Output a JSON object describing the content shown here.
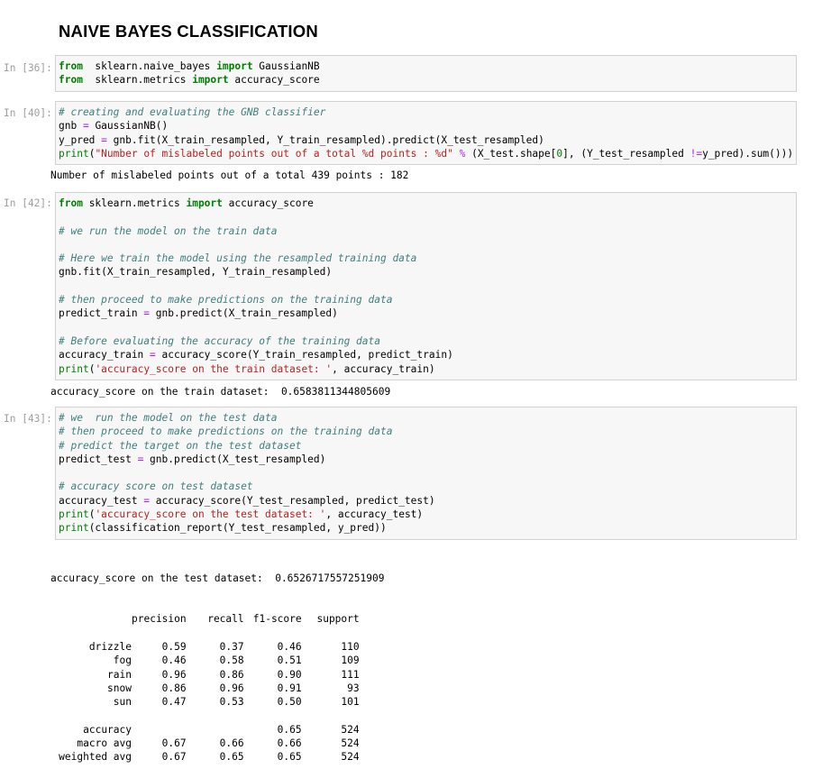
{
  "heading": "NAIVE BAYES CLASSIFICATION",
  "cells": [
    {
      "prompt": "In [36]:",
      "lines": [
        [
          [
            "kw",
            "from"
          ],
          [
            "",
            "  sklearn.naive_bayes "
          ],
          [
            "kw",
            "import"
          ],
          [
            "",
            " GaussianNB"
          ]
        ],
        [
          [
            "kw",
            "from"
          ],
          [
            "",
            "  sklearn.metrics "
          ],
          [
            "kw",
            "import"
          ],
          [
            "",
            " accuracy_score"
          ]
        ]
      ]
    },
    {
      "prompt": "In [40]:",
      "lines": [
        [
          [
            "cm",
            "# creating and evaluating the GNB classifier"
          ]
        ],
        [
          [
            "",
            "gnb "
          ],
          [
            "op",
            "="
          ],
          [
            "",
            " GaussianNB()"
          ]
        ],
        [
          [
            "",
            "y_pred "
          ],
          [
            "op",
            "="
          ],
          [
            "",
            " gnb.fit(X_train_resampled, Y_train_resampled).predict(X_test_resampled)"
          ]
        ],
        [
          [
            "nm",
            "print"
          ],
          [
            "",
            "("
          ],
          [
            "st",
            "\"Number of mislabeled points out of a total %d points : %d\""
          ],
          [
            "",
            " "
          ],
          [
            "op",
            "%"
          ],
          [
            "",
            " (X_test.shape["
          ],
          [
            "nm",
            "0"
          ],
          [
            "",
            "], (Y_test_resampled "
          ],
          [
            "op",
            "!="
          ],
          [
            "",
            "y_pred).sum()))"
          ]
        ]
      ],
      "output": [
        "Number of mislabeled points out of a total 439 points : 182"
      ]
    },
    {
      "prompt": "In [42]:",
      "lines": [
        [
          [
            "kw",
            "from"
          ],
          [
            "",
            " sklearn.metrics "
          ],
          [
            "kw",
            "import"
          ],
          [
            "",
            " accuracy_score"
          ]
        ],
        [],
        [
          [
            "cm",
            "# we run the model on the train data"
          ]
        ],
        [],
        [
          [
            "cm",
            "# Here we train the model using the resampled training data"
          ]
        ],
        [
          [
            "",
            "gnb.fit(X_train_resampled, Y_train_resampled)"
          ]
        ],
        [],
        [
          [
            "cm",
            "# then proceed to make predictions on the training data"
          ]
        ],
        [
          [
            "",
            "predict_train "
          ],
          [
            "op",
            "="
          ],
          [
            "",
            " gnb.predict(X_train_resampled)"
          ]
        ],
        [],
        [
          [
            "cm",
            "# Before evaluating the accuracy of the training data"
          ]
        ],
        [
          [
            "",
            "accuracy_train "
          ],
          [
            "op",
            "="
          ],
          [
            "",
            " accuracy_score(Y_train_resampled, predict_train)"
          ]
        ],
        [
          [
            "nm",
            "print"
          ],
          [
            "",
            "("
          ],
          [
            "st",
            "'accuracy_score on the train dataset: '"
          ],
          [
            "",
            ", accuracy_train)"
          ]
        ]
      ],
      "output": [
        "accuracy_score on the train dataset:  0.6583811344805609"
      ]
    },
    {
      "prompt": "In [43]:",
      "lines": [
        [
          [
            "cm",
            "# we  run the model on the test data"
          ]
        ],
        [
          [
            "cm",
            "# then proceed to make predictions on the training data"
          ]
        ],
        [
          [
            "cm",
            "# predict the target on the test dataset"
          ]
        ],
        [
          [
            "",
            "predict_test "
          ],
          [
            "op",
            "="
          ],
          [
            "",
            " gnb.predict(X_test_resampled)"
          ]
        ],
        [],
        [
          [
            "cm",
            "# accuracy score on test dataset"
          ]
        ],
        [
          [
            "",
            "accuracy_test "
          ],
          [
            "op",
            "="
          ],
          [
            "",
            " accuracy_score(Y_test_resampled, predict_test)"
          ]
        ],
        [
          [
            "nm",
            "print"
          ],
          [
            "",
            "("
          ],
          [
            "st",
            "'accuracy_score on the test dataset: '"
          ],
          [
            "",
            ", accuracy_test)"
          ]
        ],
        [
          [
            "nm",
            "print"
          ],
          [
            "",
            "(classification_report(Y_test_resampled, y_pred))"
          ]
        ]
      ],
      "output": [
        "accuracy_score on the test dataset:  0.6526717557251909"
      ]
    }
  ],
  "report": {
    "headers": [
      "precision",
      "recall",
      "f1-score",
      "support"
    ],
    "rows": [
      [
        "drizzle",
        "0.59",
        "0.37",
        "0.46",
        "110"
      ],
      [
        "fog",
        "0.46",
        "0.58",
        "0.51",
        "109"
      ],
      [
        "rain",
        "0.96",
        "0.86",
        "0.90",
        "111"
      ],
      [
        "snow",
        "0.86",
        "0.96",
        "0.91",
        "93"
      ],
      [
        "sun",
        "0.47",
        "0.53",
        "0.50",
        "101"
      ]
    ],
    "summary": [
      [
        "accuracy",
        "",
        "",
        "0.65",
        "524"
      ],
      [
        "macro avg",
        "0.67",
        "0.66",
        "0.66",
        "524"
      ],
      [
        "weighted avg",
        "0.67",
        "0.65",
        "0.65",
        "524"
      ]
    ]
  }
}
